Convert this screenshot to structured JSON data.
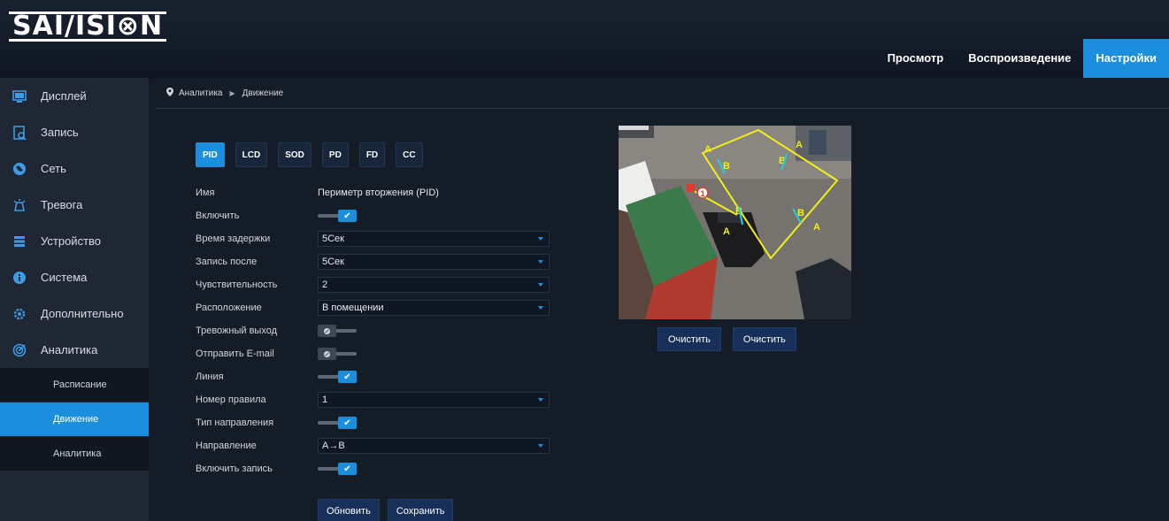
{
  "brand": {
    "logo_text": "SAI/ISI⊗N"
  },
  "nav": [
    {
      "label": "Просмотр",
      "active": false
    },
    {
      "label": "Воспроизведение",
      "active": false
    },
    {
      "label": "Настройки",
      "active": true
    }
  ],
  "sidebar": {
    "items": [
      {
        "label": "Дисплей",
        "icon": "monitor-icon"
      },
      {
        "label": "Запись",
        "icon": "record-icon"
      },
      {
        "label": "Сеть",
        "icon": "globe-icon"
      },
      {
        "label": "Тревога",
        "icon": "alarm-icon"
      },
      {
        "label": "Устройство",
        "icon": "device-icon"
      },
      {
        "label": "Система",
        "icon": "info-icon"
      },
      {
        "label": "Дополнительно",
        "icon": "gear-icon"
      },
      {
        "label": "Аналитика",
        "icon": "analytics-icon"
      }
    ],
    "sub_items": [
      {
        "label": "Расписание",
        "active": false
      },
      {
        "label": "Движение",
        "active": true
      },
      {
        "label": "Аналитика",
        "active": false
      }
    ]
  },
  "breadcrumb": {
    "root": "Аналитика",
    "current": "Движение"
  },
  "tabs": [
    {
      "label": "PID",
      "active": true
    },
    {
      "label": "LCD",
      "active": false
    },
    {
      "label": "SOD",
      "active": false
    },
    {
      "label": "PD",
      "active": false
    },
    {
      "label": "FD",
      "active": false
    },
    {
      "label": "CC",
      "active": false
    }
  ],
  "form": {
    "name": {
      "label": "Имя",
      "value": "Периметр вторжения (PID)"
    },
    "enable": {
      "label": "Включить",
      "on": true
    },
    "delay": {
      "label": "Время задержки",
      "value": "5Сек"
    },
    "record_after": {
      "label": "Запись после",
      "value": "5Сек"
    },
    "sensitivity": {
      "label": "Чувствительность",
      "value": "2"
    },
    "location": {
      "label": "Расположение",
      "value": "В помещении"
    },
    "alarm_out": {
      "label": "Тревожный выход",
      "on": false
    },
    "send_email": {
      "label": "Отправить E-mail",
      "on": false
    },
    "line": {
      "label": "Линия",
      "on": true
    },
    "rule_number": {
      "label": "Номер правила",
      "value": "1"
    },
    "direction_type": {
      "label": "Тип направления",
      "on": true
    },
    "direction": {
      "label": "Направление",
      "value": "A→B"
    },
    "enable_record": {
      "label": "Включить запись",
      "on": true
    }
  },
  "buttons": {
    "refresh": "Обновить",
    "save": "Сохранить",
    "clear1": "Очистить",
    "clear2": "Очистить"
  },
  "preview": {
    "zone_color": "#f2ee1a",
    "arrow_color": "#1fd0e6",
    "label_a": "A",
    "label_b": "B",
    "rule_badge": "1"
  },
  "colors": {
    "accent": "#1b8fde",
    "background": "#141c28",
    "sidebar": "#1f2734"
  }
}
